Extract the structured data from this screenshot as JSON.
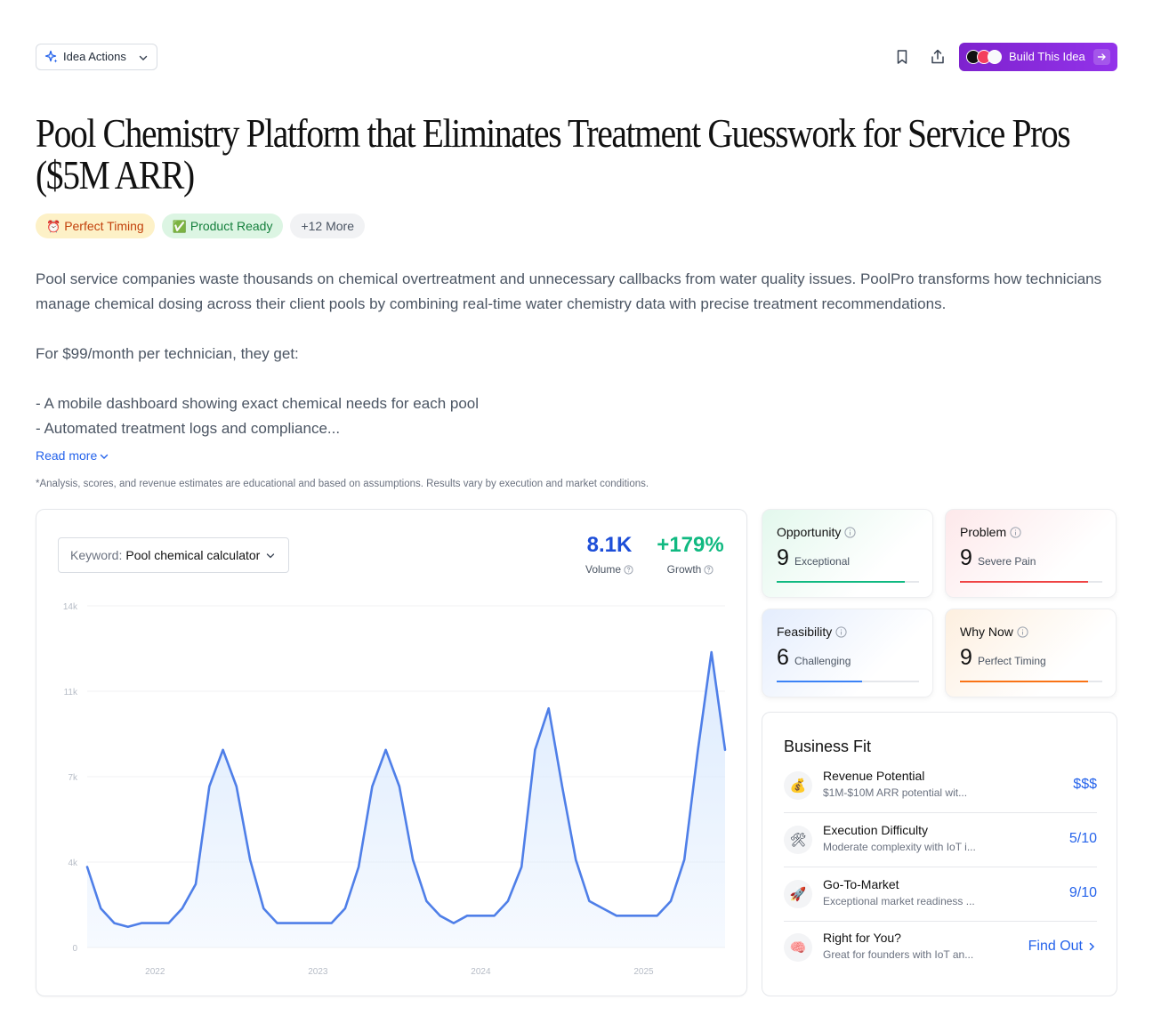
{
  "toolbar": {
    "idea_actions_label": "Idea Actions",
    "build_label": "Build This Idea"
  },
  "title": "Pool Chemistry Platform that Eliminates Treatment Guesswork for Service Pros ($5M ARR)",
  "badges": [
    {
      "icon": "⏰",
      "label": "Perfect Timing"
    },
    {
      "icon": "✅",
      "label": "Product Ready"
    },
    {
      "label": "+12 More"
    }
  ],
  "description": {
    "para1": "Pool service companies waste thousands on chemical overtreatment and unnecessary callbacks from water quality issues. PoolPro transforms how technicians manage chemical dosing across their client pools by combining real-time water chemistry data with precise treatment recommendations.",
    "para2": "For $99/month per technician, they get:",
    "bullet1": "- A mobile dashboard showing exact chemical needs for each pool",
    "bullet2": "- Automated treatment logs and compliance...",
    "read_more": "Read more"
  },
  "disclaimer": "*Analysis, scores, and revenue estimates are educational and based on assumptions. Results vary by execution and market conditions.",
  "trend": {
    "keyword_label": "Keyword:",
    "keyword_value": "Pool chemical calculator",
    "volume_value": "8.1K",
    "volume_label": "Volume",
    "growth_value": "+179%",
    "growth_label": "Growth"
  },
  "chart_data": {
    "type": "area",
    "y_ticks": [
      "0",
      "4k",
      "7k",
      "11k",
      "14k"
    ],
    "ylim": [
      0,
      14000
    ],
    "x_ticks": [
      "2022",
      "2023",
      "2024",
      "2025"
    ],
    "x_tick_index": [
      5,
      17,
      29,
      41
    ],
    "values": [
      3300,
      1600,
      1000,
      850,
      1000,
      1000,
      1000,
      1600,
      2600,
      6600,
      8100,
      6600,
      3600,
      1600,
      1000,
      1000,
      1000,
      1000,
      1000,
      1600,
      3300,
      6600,
      8100,
      6600,
      3600,
      1900,
      1300,
      1000,
      1300,
      1300,
      1300,
      1900,
      3300,
      8100,
      9800,
      6600,
      3600,
      1900,
      1600,
      1300,
      1300,
      1300,
      1300,
      1900,
      3600,
      8100,
      12100,
      8100
    ],
    "line_color": "#4f7fe8",
    "fill_color": "#dbeafe"
  },
  "scores": {
    "opportunity": {
      "title": "Opportunity",
      "value": "9",
      "word": "Exceptional",
      "fill": 0.9,
      "color": "#10b981"
    },
    "problem": {
      "title": "Problem",
      "value": "9",
      "word": "Severe Pain",
      "fill": 0.9,
      "color": "#ef4444"
    },
    "feasibility": {
      "title": "Feasibility",
      "value": "6",
      "word": "Challenging",
      "fill": 0.6,
      "color": "#3b82f6"
    },
    "why_now": {
      "title": "Why Now",
      "value": "9",
      "word": "Perfect Timing",
      "fill": 0.9,
      "color": "#f97316"
    }
  },
  "business_fit": {
    "title": "Business Fit",
    "rows": [
      {
        "icon": "💰",
        "name": "Revenue Potential",
        "sub": "$1M-$10M ARR potential wit...",
        "value": "$$$"
      },
      {
        "icon": "🛠",
        "name": "Execution Difficulty",
        "sub": "Moderate complexity with IoT i...",
        "value": "5/10"
      },
      {
        "icon": "🚀",
        "name": "Go-To-Market",
        "sub": "Exceptional market readiness ...",
        "value": "9/10"
      },
      {
        "icon": "🧠",
        "name": "Right for You?",
        "sub": "Great for founders with IoT an...",
        "value": "Find Out"
      }
    ]
  },
  "colors": {
    "accent_blue": "#2563eb",
    "build_purple": "#9333ea",
    "growth_green": "#10b981"
  }
}
